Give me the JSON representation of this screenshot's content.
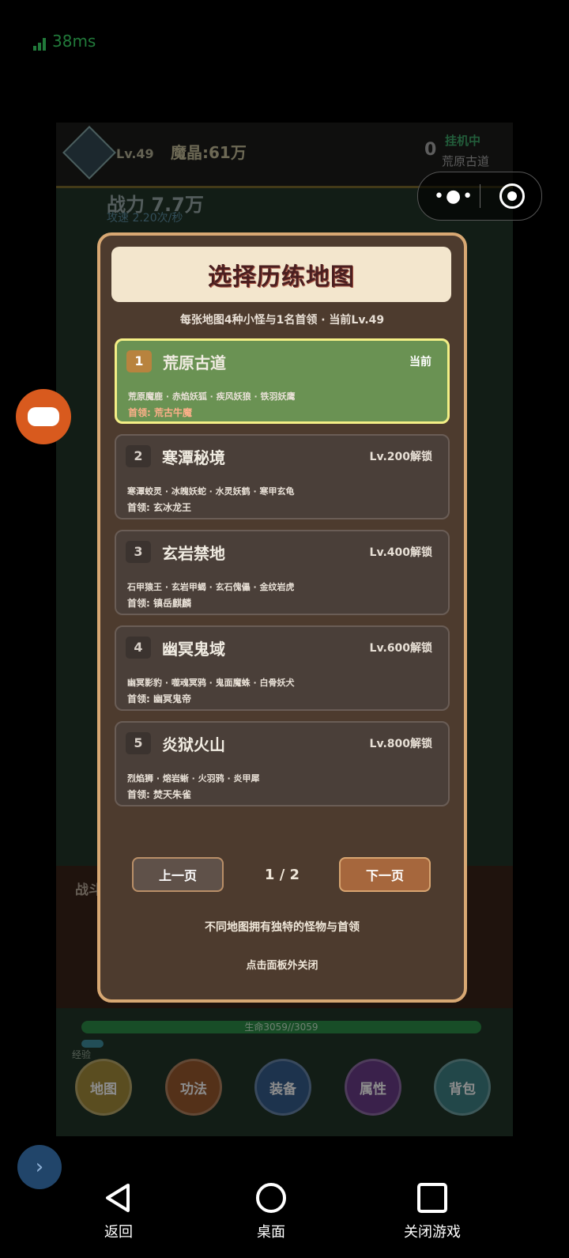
{
  "status": {
    "ping": "38ms"
  },
  "game": {
    "level": "Lv.49",
    "crystal": "魔晶:61万",
    "zero": "0",
    "idle_status": "挂机中",
    "idle_map": "荒原古道",
    "power": "战力 7.7万",
    "attack_speed": "攻速 2.20次/秒",
    "battle_label": "战斗",
    "hp_text": "生命3059//3059",
    "exp_label": "经验",
    "nav": [
      "地图",
      "功法",
      "装备",
      "属性",
      "背包"
    ],
    "nav_colors": [
      "#a48c3b",
      "#9a5a2e",
      "#365e8c",
      "#6a3c89",
      "#3f8185"
    ]
  },
  "modal": {
    "title": "选择历练地图",
    "subtitle": "每张地图4种小怪与1名首领 · 当前Lv.49",
    "maps": [
      {
        "num": "1",
        "name": "荒原古道",
        "status": "当前",
        "monsters": "荒原魔鹿 · 赤焰妖狐 · 疾风妖狼 · 铁羽妖鹰",
        "boss": "首领: 荒古牛魔"
      },
      {
        "num": "2",
        "name": "寒潭秘境",
        "status": "Lv.200解锁",
        "monsters": "寒潭蛟灵 · 冰魄妖蛇 · 水灵妖鹤 · 寒甲玄龟",
        "boss": "首领: 玄冰龙王"
      },
      {
        "num": "3",
        "name": "玄岩禁地",
        "status": "Lv.400解锁",
        "monsters": "石甲猿王 · 玄岩甲蝎 · 玄石傀儡 · 金纹岩虎",
        "boss": "首领: 镇岳麒麟"
      },
      {
        "num": "4",
        "name": "幽冥鬼域",
        "status": "Lv.600解锁",
        "monsters": "幽冥影豹 · 噬魂冥鸦 · 鬼面魔蛛 · 白骨妖犬",
        "boss": "首领: 幽冥鬼帝"
      },
      {
        "num": "5",
        "name": "炎狱火山",
        "status": "Lv.800解锁",
        "monsters": "烈焰狮 · 熔岩蜥 · 火羽鸦 · 炎甲犀",
        "boss": "首领: 焚天朱雀"
      }
    ],
    "prev_label": "上一页",
    "page": "1 / 2",
    "next_label": "下一页",
    "tip": "不同地图拥有独特的怪物与首领",
    "close_tip": "点击面板外关闭"
  },
  "system_nav": {
    "back": "返回",
    "home": "桌面",
    "close": "关闭游戏"
  }
}
